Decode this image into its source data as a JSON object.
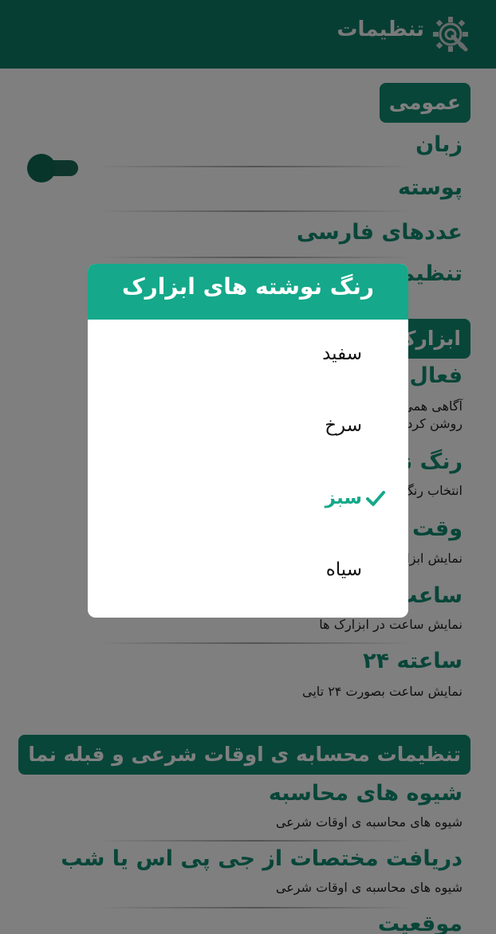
{
  "appbar": {
    "title": "تنظیمات",
    "icon": "gear-wrench-icon"
  },
  "sections": {
    "general": {
      "header": "عمومی",
      "items": {
        "language": "زبان",
        "skin": "پوسته",
        "persian_digits": "عددهای فارسی",
        "settings_partial": "تنظیم"
      }
    },
    "widgets": {
      "header_partial": "ابزارک",
      "items": {
        "activate_partial": "فعال ک",
        "activate_sub1_partial": "آگاهی همی",
        "activate_sub2_partial": "روشن کردن",
        "text_color_partial": "رنگ نو",
        "text_color_sub_partial": "انتخاب رنگ",
        "time_partial": "وقت ا",
        "time_sub_partial": "نمایش ابزا",
        "clock_partial": "ساعت",
        "clock_sub": "نمایش ساعت در ابزارک ها",
        "clock24_title": "ساعته ۲۴",
        "clock24_sub": "نمایش ساعت بصورت ۲۴ تایی"
      }
    },
    "prayer": {
      "header": "تنظیمات محسابه ی اوقات شرعی و قبله نما",
      "items": {
        "methods_title": "شیوه های محاسبه",
        "methods_sub": "شیوه های محاسبه ی اوقات شرعی",
        "gps_title": "دریافت مختصات از جی پی اس یا شب",
        "gps_sub": "شیوه های محاسبه ی اوقات شرعی",
        "location_title": "موقعیت"
      }
    }
  },
  "toggles": {
    "persian_digits_on": false
  },
  "dialog": {
    "title": "رنگ نوشته های ابزارک",
    "options": [
      "سفید",
      "سرخ",
      "سبز",
      "سیاه"
    ],
    "selected_index": 2,
    "check_icon": "checkmark-icon"
  },
  "colors": {
    "primary": "#0f7c66",
    "accent": "#15a88a",
    "section": "#118c73"
  }
}
